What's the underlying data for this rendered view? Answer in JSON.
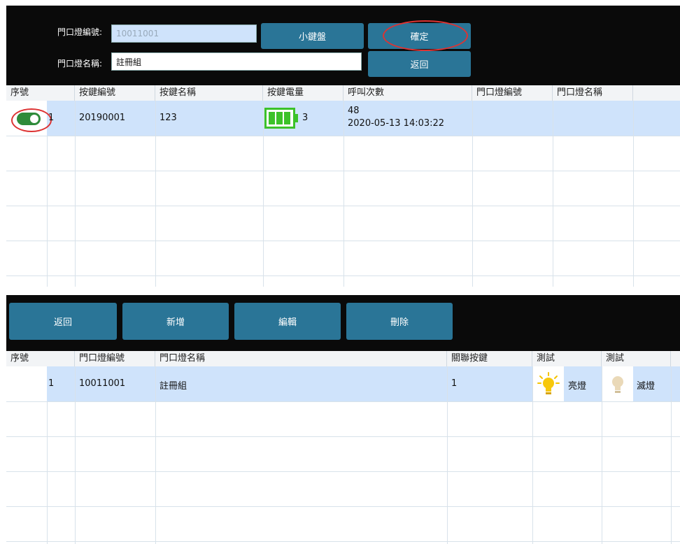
{
  "top": {
    "door_light_code_label": "門口燈編號:",
    "door_light_code_value": "10011001",
    "door_light_name_label": "門口燈名稱:",
    "door_light_name_value": "註冊組",
    "keyboard_button": "小鍵盤",
    "confirm_button": "確定",
    "back_button": "返回",
    "columns": [
      "序號",
      "按鍵編號",
      "按鍵名稱",
      "按鍵電量",
      "呼叫次數",
      "門口燈編號",
      "門口燈名稱"
    ],
    "row": {
      "serial": "1",
      "key_code": "20190001",
      "key_name": "123",
      "battery_level": "3",
      "call_count": "48",
      "call_time": "2020-05-13 14:03:22",
      "enabled": true
    }
  },
  "bottom": {
    "buttons": {
      "back": "返回",
      "add": "新增",
      "edit": "編輯",
      "delete": "刪除"
    },
    "columns": [
      "序號",
      "門口燈編號",
      "門口燈名稱",
      "關聯按鍵",
      "測試",
      "測試"
    ],
    "row": {
      "serial": "1",
      "door_light_code": "10011001",
      "door_light_name": "註冊組",
      "linked_key": "1",
      "light_on": "亮燈",
      "light_off": "滅燈"
    }
  },
  "colors": {
    "button": "#2a7597",
    "selected_row": "#cfe3fb",
    "battery": "#3cc22a",
    "toggle": "#2e8b3a",
    "highlight_circle": "#dd3333"
  }
}
